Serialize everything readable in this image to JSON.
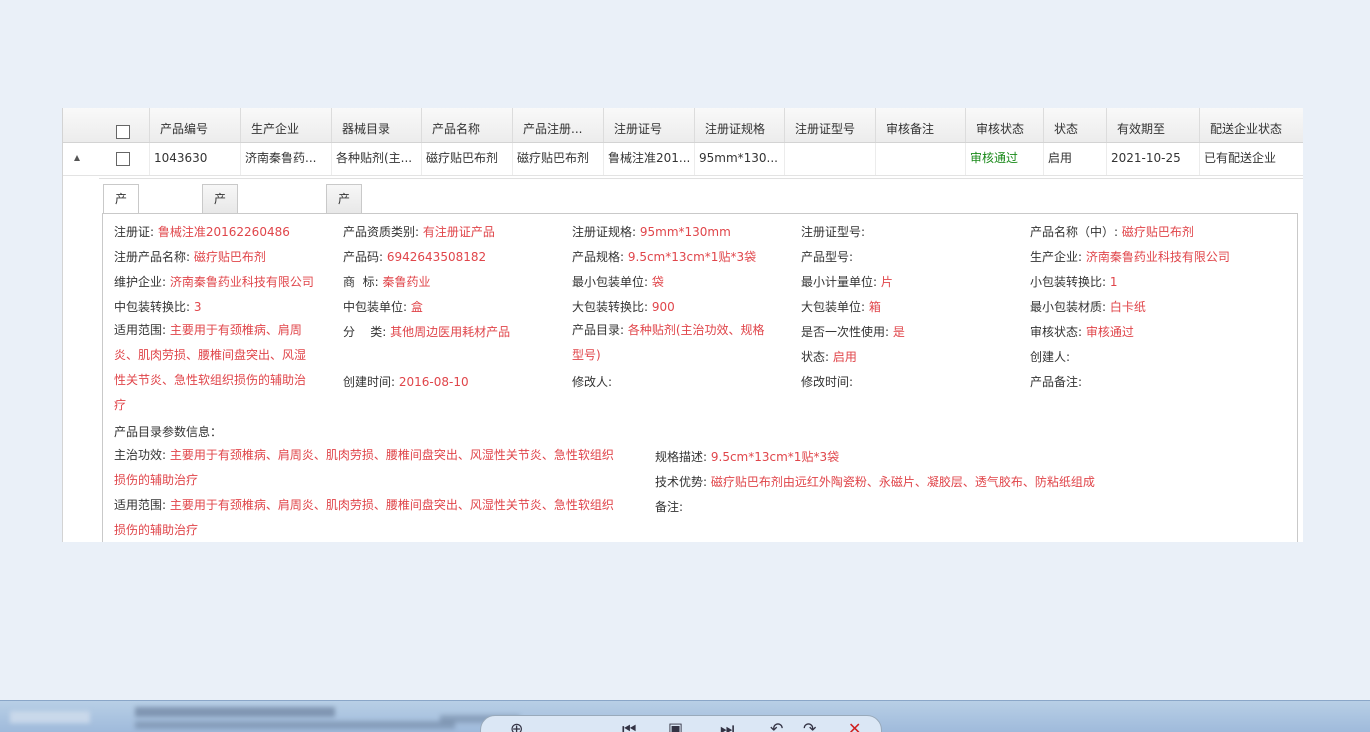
{
  "table": {
    "headers": [
      "产品编号",
      "生产企业",
      "器械目录",
      "产品名称",
      "产品注册...",
      "注册证号",
      "注册证规格",
      "注册证型号",
      "审核备注",
      "审核状态",
      "状态",
      "有效期至",
      "配送企业状态"
    ],
    "row": [
      "1043630",
      "济南秦鲁药...",
      "各种贴剂(主...",
      "磁疗贴巴布剂",
      "磁疗贴巴布剂",
      "鲁械注准201...",
      "95mm*130...",
      "",
      "",
      "审核通过",
      "启用",
      "2021-10-25",
      "已有配送企业"
    ]
  },
  "tabs": [
    "产品详细信息",
    "产品配送区域信息",
    "产品配送许可范围资质"
  ],
  "fields": [
    {
      "label": "注册证:",
      "value": "鲁械注准20162260486"
    },
    {
      "label": "产品资质类别:",
      "value": "有注册证产品"
    },
    {
      "label": "注册证规格:",
      "value": "95mm*130mm"
    },
    {
      "label": "注册证型号:",
      "value": ""
    },
    {
      "label": "产品名称（中）:",
      "value": "磁疗贴巴布剂"
    },
    {
      "label": "注册产品名称:",
      "value": "磁疗贴巴布剂"
    },
    {
      "label": "产品码:",
      "value": "6942643508182"
    },
    {
      "label": "产品规格:",
      "value": "9.5cm*13cm*1贴*3袋"
    },
    {
      "label": "产品型号:",
      "value": ""
    },
    {
      "label": "生产企业:",
      "value": "济南秦鲁药业科技有限公司"
    },
    {
      "label": "维护企业:",
      "value": "济南秦鲁药业科技有限公司"
    },
    {
      "label": "商  标:",
      "value": "秦鲁药业"
    },
    {
      "label": "最小包装单位:",
      "value": "袋"
    },
    {
      "label": "最小计量单位:",
      "value": "片"
    },
    {
      "label": "小包装转换比:",
      "value": "1"
    },
    {
      "label": "中包装转换比:",
      "value": "3"
    },
    {
      "label": "中包装单位:",
      "value": "盒"
    },
    {
      "label": "大包装转换比:",
      "value": "900"
    },
    {
      "label": "大包装单位:",
      "value": "箱"
    },
    {
      "label": "最小包装材质:",
      "value": "白卡纸"
    },
    {
      "label": "分    类:",
      "value": "其他周边医用耗材产品"
    },
    {
      "label": "是否一次性使用:",
      "value": "是"
    },
    {
      "label": "审核状态:",
      "value": "审核通过"
    },
    {
      "label": "状态:",
      "value": "启用"
    },
    {
      "label": "创建人:",
      "value": ""
    },
    {
      "label": "创建时间:",
      "value": "2016-08-10"
    },
    {
      "label": "修改人:",
      "value": ""
    },
    {
      "label": "修改时间:",
      "value": ""
    },
    {
      "label": "产品备注:",
      "value": ""
    }
  ],
  "scope": {
    "label": "适用范围:",
    "lines": [
      "主要用于有颈椎病、肩周",
      "炎、肌肉劳损、腰椎间盘突出、风湿",
      "性关节炎、急性软组织损伤的辅助治",
      "疗"
    ]
  },
  "catalog": {
    "label": "产品目录:",
    "lines": [
      "各种贴剂(主治功效、规格",
      "型号)"
    ]
  },
  "params": {
    "title": "产品目录参数信息：",
    "effect_label": "主治功效:",
    "effect_lines": [
      "主要用于有颈椎病、肩周炎、肌肉劳损、腰椎间盘突出、风湿性关节炎、急性软组织",
      "损伤的辅助治疗"
    ],
    "scope_label": "适用范围:",
    "scope_lines": [
      "主要用于有颈椎病、肩周炎、肌肉劳损、腰椎间盘突出、风湿性关节炎、急性软组织",
      "损伤的辅助治疗"
    ],
    "spec_label": "规格描述:",
    "spec_value": "9.5cm*13cm*1贴*3袋",
    "tech_label": "技术优势:",
    "tech_value": "磁疗贴巴布剂由远红外陶瓷粉、永磁片、凝胶层、透气胶布、防粘纸组成",
    "note_label": "备注:"
  },
  "colors": {
    "value_red": "#e0454a",
    "status_green": "#1a8a1a"
  }
}
